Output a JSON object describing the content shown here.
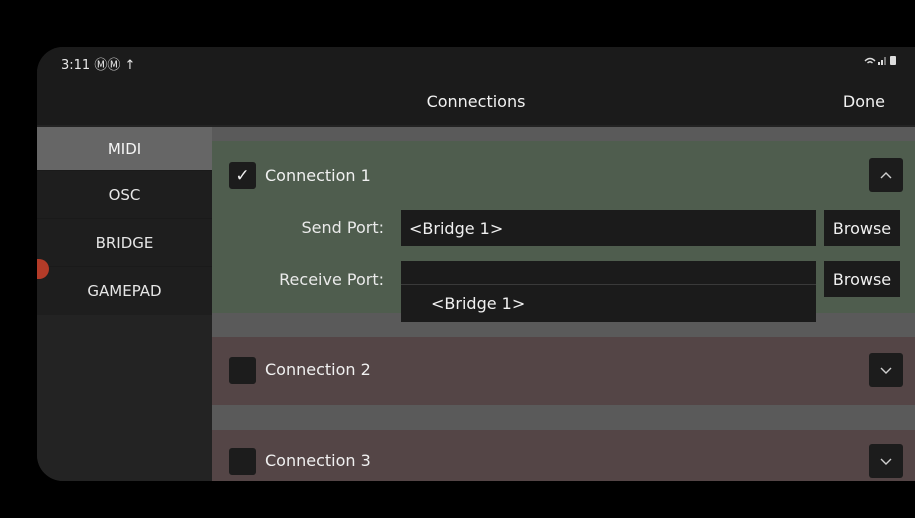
{
  "status": {
    "time": "3:11 ⓂⓂ ↑",
    "icons": "📶 ▮"
  },
  "navbar": {
    "title": "Connections",
    "done_label": "Done"
  },
  "sidebar": {
    "items": [
      {
        "label": "MIDI",
        "active": true
      },
      {
        "label": "OSC"
      },
      {
        "label": "BRIDGE"
      },
      {
        "label": "GAMEPAD"
      }
    ]
  },
  "connections": [
    {
      "label": "Connection 1",
      "checked": true,
      "check_glyph": "✓",
      "expanded": true,
      "send_port_label": "Send Port:",
      "send_port_value": "<Bridge 1>",
      "receive_port_label": "Receive Port:",
      "receive_port_value": "",
      "browse_label": "Browse",
      "dropdown_option": "<Bridge 1>"
    },
    {
      "label": "Connection 2",
      "checked": false,
      "expanded": false
    },
    {
      "label": "Connection 3",
      "checked": false,
      "expanded": false
    }
  ],
  "colors": {
    "expanded_bg": "#4f5d4e",
    "collapsed_bg": "#544546",
    "accent_red": "#b33b28"
  }
}
